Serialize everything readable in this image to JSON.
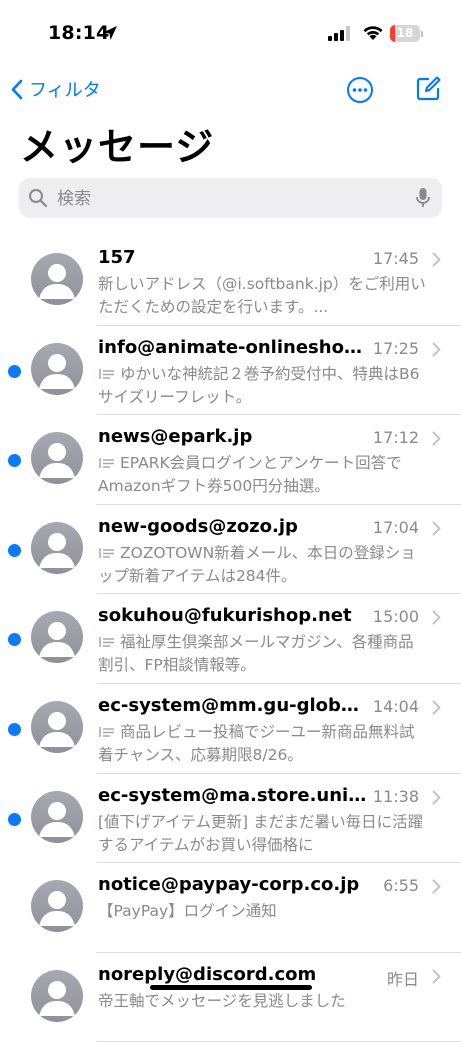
{
  "status": {
    "time": "18:14",
    "battery": "18",
    "battery_level": 0.18,
    "battery_color": "#ff3b30"
  },
  "nav": {
    "back_label": "フィルタ",
    "more_icon": "ellipsis-circle-icon",
    "compose_icon": "compose-icon"
  },
  "title": "メッセージ",
  "search": {
    "placeholder": "検索"
  },
  "accent": "#007aff",
  "unread_color": "#0a7aff",
  "conversations": [
    {
      "sender": "157",
      "time": "17:45",
      "unread": false,
      "reply": false,
      "preview": "新しいアドレス（@i.softbank.jp）をご利用いただくための設定を行います。..."
    },
    {
      "sender": "info@animate-onlineshop.jp",
      "time": "17:25",
      "unread": true,
      "reply": true,
      "preview": "ゆかいな神統記２巻予約受付中、特典はB6サイズリーフレット。"
    },
    {
      "sender": "news@epark.jp",
      "time": "17:12",
      "unread": true,
      "reply": true,
      "preview": "EPARK会員ログインとアンケート回答でAmazonギフト券500円分抽選。"
    },
    {
      "sender": "new-goods@zozo.jp",
      "time": "17:04",
      "unread": true,
      "reply": true,
      "preview": "ZOZOTOWN新着メール、本日の登録ショップ新着アイテムは284件。"
    },
    {
      "sender": "sokuhou@fukurishop.net",
      "time": "15:00",
      "unread": true,
      "reply": true,
      "preview": "福祉厚生倶楽部メールマガジン、各種商品割引、FP相談情報等。"
    },
    {
      "sender": "ec-system@mm.gu-global....",
      "time": "14:04",
      "unread": true,
      "reply": true,
      "preview": "商品レビュー投稿でジーユー新商品無料試着チャンス、応募期限8/26。"
    },
    {
      "sender": "ec-system@ma.store.uniql...",
      "time": "11:38",
      "unread": true,
      "reply": false,
      "preview": "[値下げアイテム更新] まだまだ暑い毎日に活躍するアイテムがお買い得価格に"
    },
    {
      "sender": "notice@paypay-corp.co.jp",
      "time": "6:55",
      "unread": false,
      "reply": false,
      "preview": "【PayPay】ログイン通知"
    },
    {
      "sender": "noreply@discord.com",
      "time": "昨日",
      "unread": false,
      "reply": false,
      "preview": "帝王軸でメッセージを見逃しました"
    }
  ]
}
